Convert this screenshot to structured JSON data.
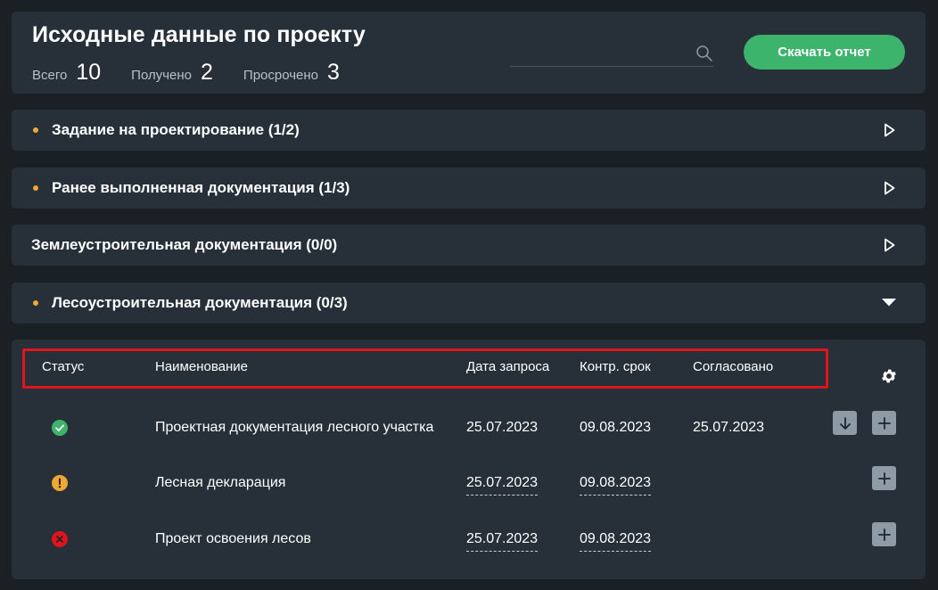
{
  "header": {
    "title": "Исходные данные по проекту",
    "stats": [
      {
        "label": "Всего",
        "value": "10"
      },
      {
        "label": "Получено",
        "value": "2"
      },
      {
        "label": "Просрочено",
        "value": "3"
      }
    ],
    "search": {
      "value": "",
      "placeholder": ""
    },
    "download_label": "Скачать отчет"
  },
  "sections": [
    {
      "title": "Задание на проектирование (1/2)",
      "has_dot": true,
      "expanded": false
    },
    {
      "title": "Ранее выполненная документация (1/3)",
      "has_dot": true,
      "expanded": false
    },
    {
      "title": "Землеустроительная документация (0/0)",
      "has_dot": false,
      "expanded": false
    },
    {
      "title": "Лесоустроительная документация (0/3)",
      "has_dot": true,
      "expanded": true
    }
  ],
  "table": {
    "columns": {
      "status": "Статус",
      "name": "Наименование",
      "request_date": "Дата запроса",
      "deadline": "Контр. срок",
      "approved": "Согласовано"
    },
    "rows": [
      {
        "status": "ok",
        "name": "Проектная документация лесного участка",
        "request_date": "25.07.2023",
        "deadline": "09.08.2023",
        "approved": "25.07.2023",
        "has_download": true
      },
      {
        "status": "warning",
        "name": "Лесная декларация",
        "request_date": "25.07.2023",
        "deadline": "09.08.2023",
        "approved": "",
        "has_download": false
      },
      {
        "status": "error",
        "name": "Проект освоения лесов",
        "request_date": "25.07.2023",
        "deadline": "09.08.2023",
        "approved": "",
        "has_download": false
      }
    ]
  },
  "colors": {
    "background": "#1b2025",
    "card": "#273038",
    "accent_green": "#3db46b",
    "warning_orange": "#f0a733",
    "error_red": "#e0141b",
    "highlight_border": "#e0141b"
  },
  "icons": {
    "search": "search-icon",
    "expand_closed": "play-outline-icon",
    "expand_open": "caret-down-icon",
    "settings": "gear-icon",
    "download": "arrow-down-icon",
    "add": "plus-icon"
  }
}
